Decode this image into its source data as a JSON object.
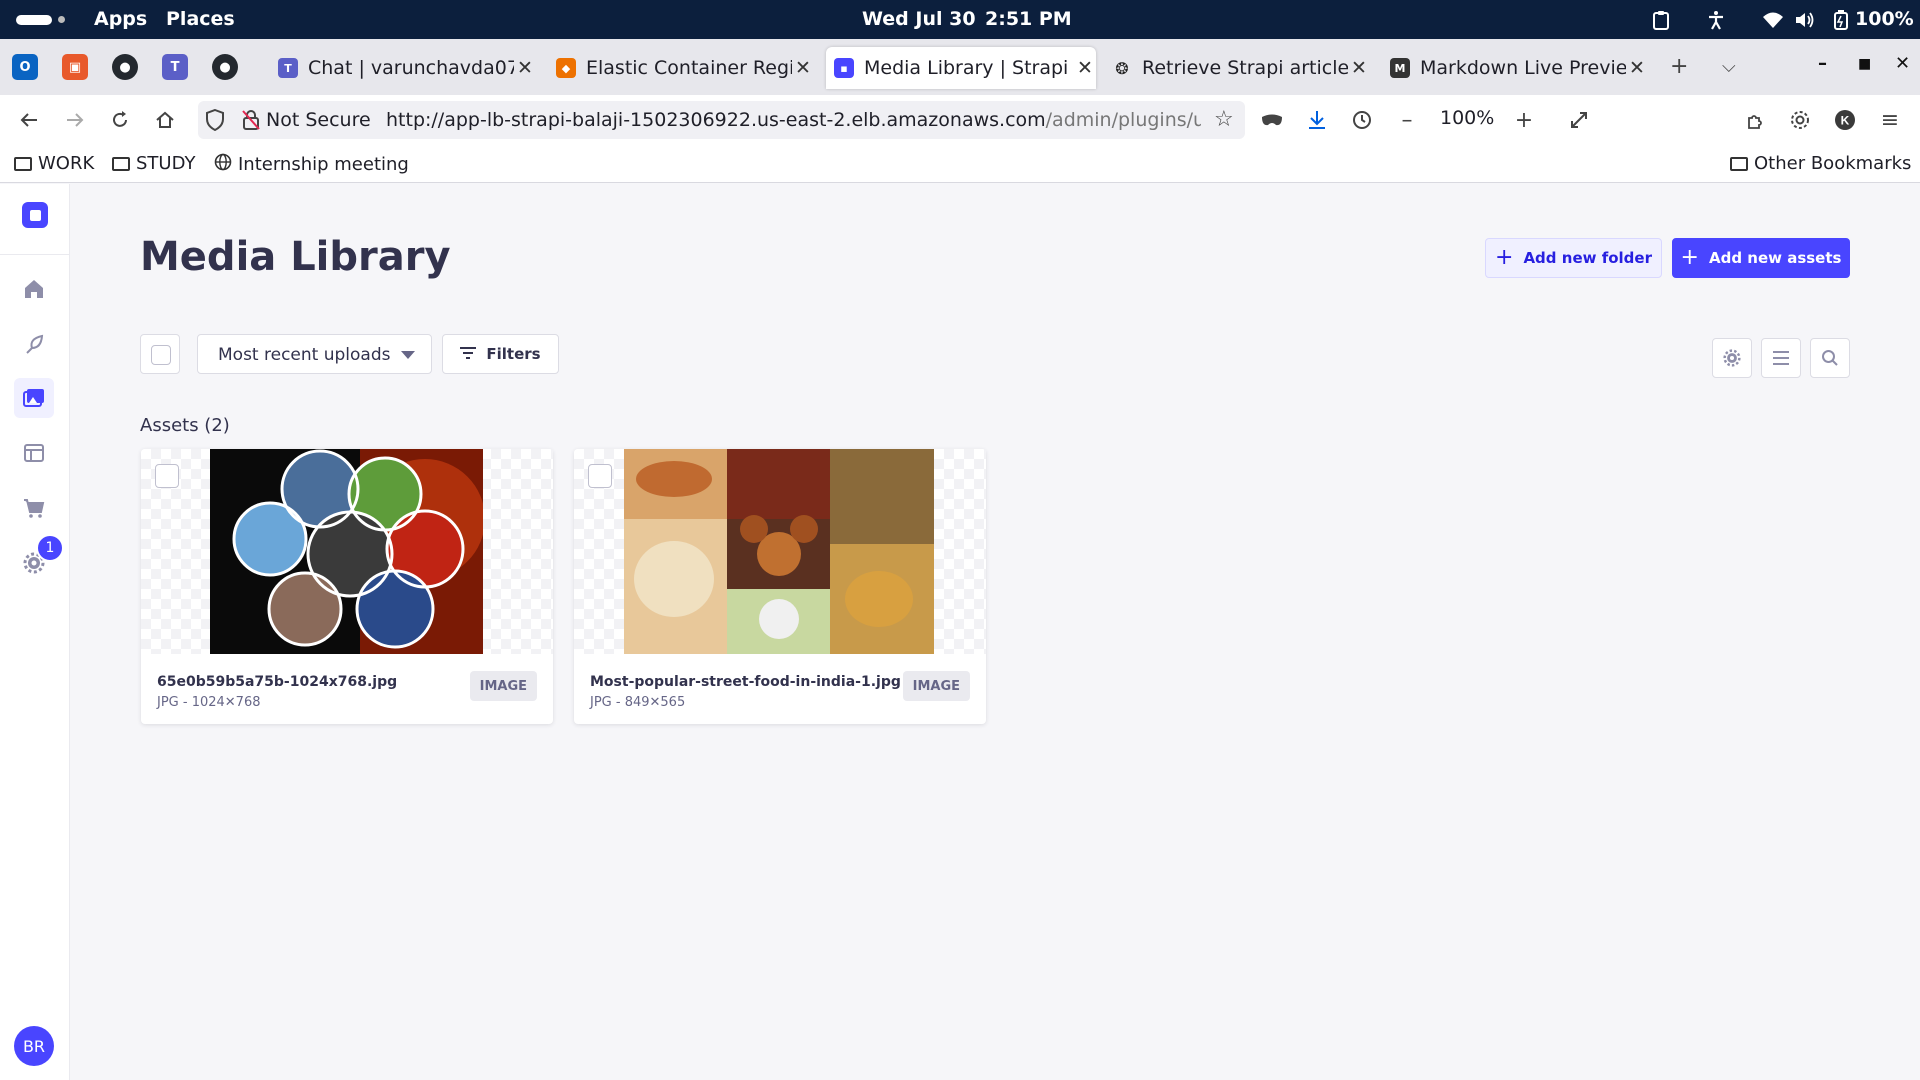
{
  "system_bar": {
    "apps": "Apps",
    "places": "Places",
    "date": "Wed Jul 30",
    "time": "2:51 PM",
    "battery": "100%"
  },
  "tabs": [
    {
      "label": "Chat | varunchavda078",
      "icon": "teams-icon",
      "active": false
    },
    {
      "label": "Elastic Container Regist",
      "icon": "aws-icon",
      "active": false
    },
    {
      "label": "Media Library | Strapi",
      "icon": "strapi-icon",
      "active": true
    },
    {
      "label": "Retrieve Strapi article da",
      "icon": "openai-icon",
      "active": false
    },
    {
      "label": "Markdown Live Preview",
      "icon": "markdown-icon",
      "active": false
    }
  ],
  "nav": {
    "security_label": "Not Secure",
    "url_main": "http://app-lb-strapi-balaji-1502306922.us-east-2.elb.amazonaws.com",
    "url_path": "/admin/plugins/upl",
    "zoom": "100%"
  },
  "bookmarks": {
    "items": [
      "WORK",
      "STUDY",
      "Internship meeting"
    ],
    "other": "Other Bookmarks"
  },
  "sidebar": {
    "notification_count": "1",
    "avatar_initials": "BR"
  },
  "page": {
    "title": "Media Library",
    "add_folder": "Add new folder",
    "add_assets": "Add new assets",
    "sort_value": "Most recent uploads",
    "filters": "Filters",
    "assets_heading": "Assets (2)"
  },
  "assets": [
    {
      "name": "65e0b59b5a75b-1024x768.jpg",
      "meta": "JPG - 1024✕768",
      "type": "IMAGE"
    },
    {
      "name": "Most-popular-street-food-in-india-1.jpg",
      "meta": "JPG - 849✕565",
      "type": "IMAGE"
    }
  ],
  "colors": {
    "primary": "#4945ff",
    "system_bar": "#0c1f3d"
  }
}
